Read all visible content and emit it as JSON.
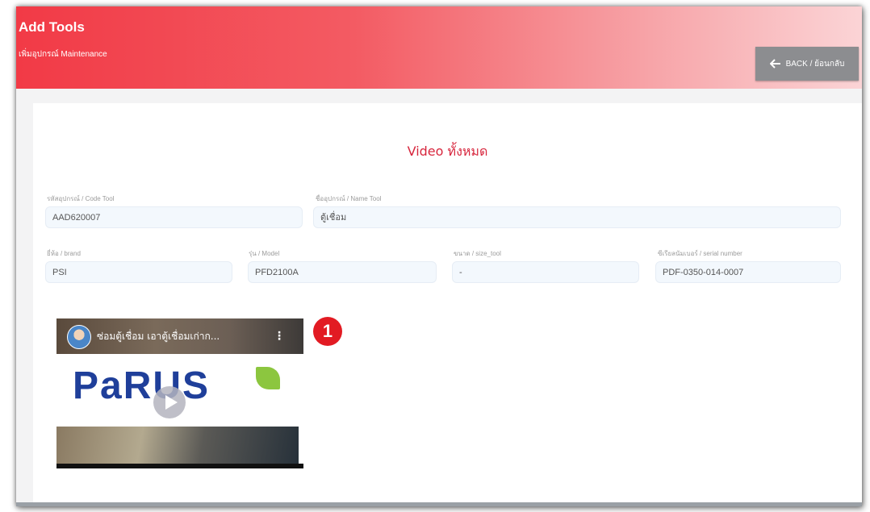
{
  "header": {
    "title": "Add Tools",
    "subtitle": "เพิ่มอุปกรณ์ Maintenance",
    "back_label": "BACK / ย้อนกลับ"
  },
  "section": {
    "title": "Video ทั้งหมด"
  },
  "fields": {
    "code_tool": {
      "label": "รหัสอุปกรณ์ / Code Tool",
      "value": "AAD620007"
    },
    "name_tool": {
      "label": "ชื่ออุปกรณ์ / Name Tool",
      "value": "ตู้เชื่อม"
    },
    "brand": {
      "label": "ยี่ห้อ / brand",
      "value": "PSI"
    },
    "model": {
      "label": "รุ่น / Model",
      "value": "PFD2100A"
    },
    "size_tool": {
      "label": "ขนาด / size_tool",
      "value": "-"
    },
    "serial": {
      "label": "ซีเรียลนัมเบอร์ / serial number",
      "value": "PDF-0350-014-0007"
    }
  },
  "video": {
    "title": "ซ่อมตู้เชื่อม เอาตู้เชื่อมเก่าก...",
    "logo_text": "PaRUS"
  },
  "annotation": {
    "badge": "1"
  },
  "icons": {
    "back": "arrow-left-icon",
    "menu": "more-vert-icon",
    "play": "play-icon"
  },
  "colors": {
    "header_red": "#f23a46",
    "title_red": "#d7263d",
    "back_button": "#8c8d90"
  }
}
